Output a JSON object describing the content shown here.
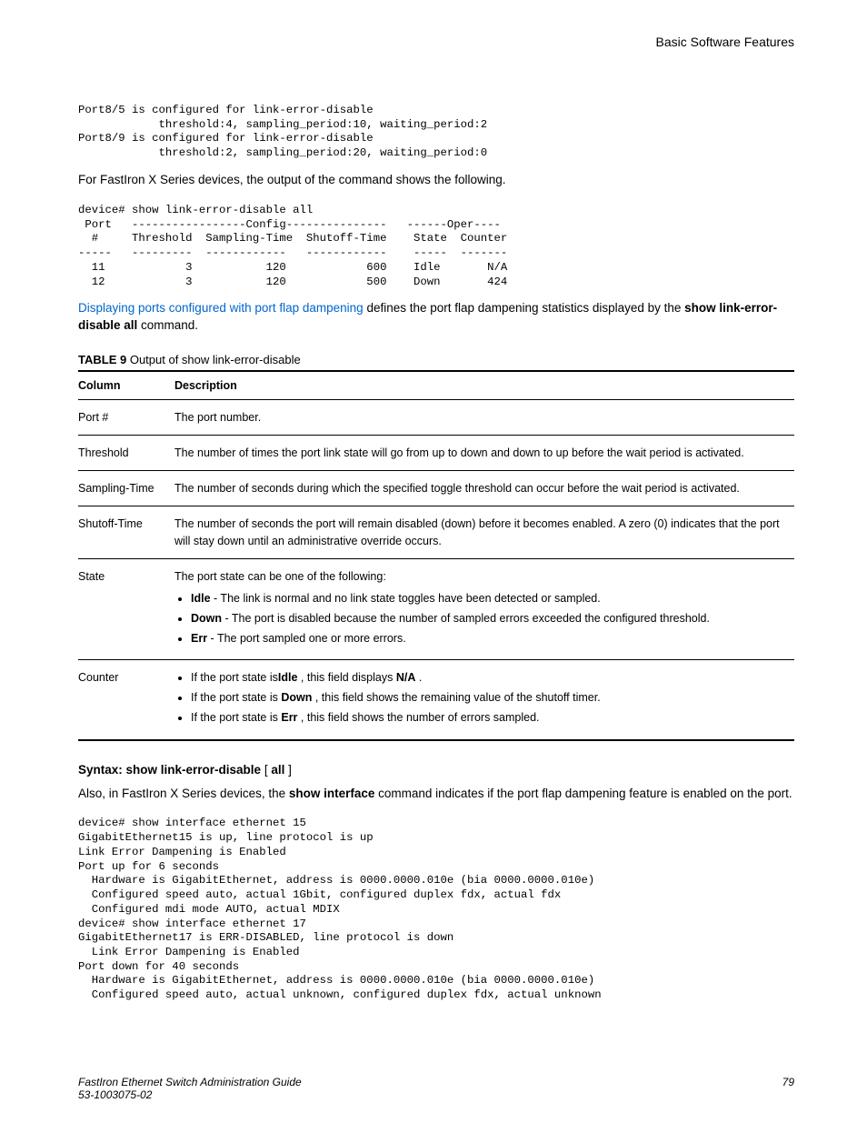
{
  "header": {
    "section": "Basic Software Features"
  },
  "codeblock1": "Port8/5 is configured for link-error-disable\n            threshold:4, sampling_period:10, waiting_period:2\nPort8/9 is configured for link-error-disable\n            threshold:2, sampling_period:20, waiting_period:0",
  "para1": "For FastIron X Series devices, the output of the command shows the following.",
  "codeblock2": "device# show link-error-disable all\n Port   -----------------Config---------------   ------Oper----\n  #     Threshold  Sampling-Time  Shutoff-Time    State  Counter\n-----   ---------  ------------   ------------    -----  -------\n  11            3           120            600    Idle       N/A\n  12            3           120            500    Down       424",
  "para2_link": "Displaying ports configured with port flap dampening",
  "para2_mid": " defines the port flap dampening statistics displayed by the ",
  "para2_cmd": "show link-error-disable all",
  "para2_end": " command.",
  "table": {
    "caption_label": "TABLE 9",
    "caption_text": "   Output of show link-error-disable",
    "head_col": "Column",
    "head_desc": "Description",
    "rows": {
      "r1c1": "Port #",
      "r1c2": "The port number.",
      "r2c1": "Threshold",
      "r2c2": "The number of times the port link state will go from up to down and down to up before the wait period is activated.",
      "r3c1": "Sampling-Time",
      "r3c2": "The number of seconds during which the specified toggle threshold can occur before the wait period is activated.",
      "r4c1": "Shutoff-Time",
      "r4c2": "The number of seconds the port will remain disabled (down) before it becomes enabled. A zero (0) indicates that the port will stay down until an administrative override occurs.",
      "r5c1": "State",
      "r5c2_lead": "The port state can be one of the following:",
      "r5_b1a": "Idle",
      "r5_b1b": " - The link is normal and no link state toggles have been detected or sampled.",
      "r5_b2a": "Down",
      "r5_b2b": " - The port is disabled because the number of sampled errors exceeded the configured threshold.",
      "r5_b3a": "Err",
      "r5_b3b": " - The port sampled one or more errors.",
      "r6c1": "Counter",
      "r6_b1a": "If the port state is",
      "r6_b1b": "Idle",
      "r6_b1c": " , this field displays ",
      "r6_b1d": "N/A",
      "r6_b1e": " .",
      "r6_b2a": "If the port state is ",
      "r6_b2b": "Down",
      "r6_b2c": " , this field shows the remaining value of the shutoff timer.",
      "r6_b3a": "If the port state is ",
      "r6_b3b": "Err",
      "r6_b3c": " , this field shows the number of errors sampled."
    }
  },
  "syntax": {
    "lead": "Syntax: show link-error-disable",
    "bracket_open": " [ ",
    "opt": "all",
    "bracket_close": " ]"
  },
  "para3a": "Also, in FastIron X Series devices, the ",
  "para3b": "show interface",
  "para3c": " command indicates if the port flap dampening feature is enabled on the port.",
  "codeblock3": "device# show interface ethernet 15\nGigabitEthernet15 is up, line protocol is up \nLink Error Dampening is Enabled\nPort up for 6 seconds\n  Hardware is GigabitEthernet, address is 0000.0000.010e (bia 0000.0000.010e)\n  Configured speed auto, actual 1Gbit, configured duplex fdx, actual fdx\n  Configured mdi mode AUTO, actual MDIX\ndevice# show interface ethernet 17\nGigabitEthernet17 is ERR-DISABLED, line protocol is down\n  Link Error Dampening is Enabled\nPort down for 40 seconds\n  Hardware is GigabitEthernet, address is 0000.0000.010e (bia 0000.0000.010e)\n  Configured speed auto, actual unknown, configured duplex fdx, actual unknown",
  "footer": {
    "left1": "FastIron Ethernet Switch Administration Guide",
    "left2": "53-1003075-02",
    "right": "79"
  }
}
